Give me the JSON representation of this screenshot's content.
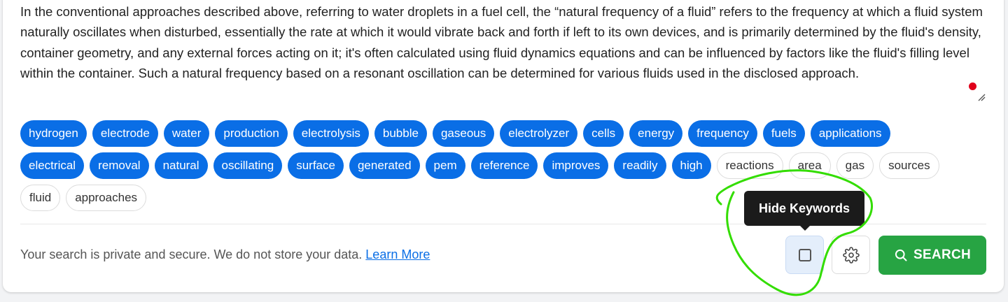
{
  "query": {
    "text": "In the conventional approaches described above, referring to water droplets in a fuel cell, the “natural frequency of a fluid” refers to the frequency at which a fluid system naturally oscillates when disturbed, essentially the rate at which it would vibrate back and forth if left to its own devices, and is primarily determined by the fluid's density, container geometry, and any external forces acting on it; it's often calculated using fluid dynamics equations and can be influenced by factors like the fluid's filling level within the container. Such a natural frequency based on a resonant oscillation can be determined for various fluids used in the disclosed approach."
  },
  "keywords": {
    "row1": [
      {
        "label": "hydrogen",
        "selected": true
      },
      {
        "label": "electrode",
        "selected": true
      },
      {
        "label": "water",
        "selected": true
      },
      {
        "label": "production",
        "selected": true
      },
      {
        "label": "electrolysis",
        "selected": true
      },
      {
        "label": "bubble",
        "selected": true
      },
      {
        "label": "gaseous",
        "selected": true
      },
      {
        "label": "electrolyzer",
        "selected": true
      },
      {
        "label": "cells",
        "selected": true
      },
      {
        "label": "energy",
        "selected": true
      },
      {
        "label": "frequency",
        "selected": true
      },
      {
        "label": "fuels",
        "selected": true
      },
      {
        "label": "applications",
        "selected": true
      }
    ],
    "row2": [
      {
        "label": "electrical",
        "selected": true
      },
      {
        "label": "removal",
        "selected": true
      },
      {
        "label": "natural",
        "selected": true
      },
      {
        "label": "oscillating",
        "selected": true
      },
      {
        "label": "surface",
        "selected": true
      },
      {
        "label": "generated",
        "selected": true
      },
      {
        "label": "pem",
        "selected": true
      },
      {
        "label": "reference",
        "selected": true
      },
      {
        "label": "improves",
        "selected": true
      },
      {
        "label": "readily",
        "selected": true
      },
      {
        "label": "high",
        "selected": true
      },
      {
        "label": "reactions",
        "selected": false
      },
      {
        "label": "area",
        "selected": false
      },
      {
        "label": "gas",
        "selected": false
      },
      {
        "label": "sources",
        "selected": false
      }
    ],
    "row3": [
      {
        "label": "fluid",
        "selected": false
      },
      {
        "label": "approaches",
        "selected": false
      }
    ]
  },
  "footer": {
    "privacy_text": "Your search is private and secure. We do not store your data.",
    "learn_more": "Learn More",
    "search_label": "SEARCH",
    "tooltip": "Hide Keywords"
  },
  "colors": {
    "chip_selected": "#0a6ee6",
    "search_button": "#27a443",
    "annotation": "#33dd00"
  },
  "icons": {
    "toggle": "checkbox-icon",
    "settings": "gear-icon",
    "search": "search-icon"
  }
}
